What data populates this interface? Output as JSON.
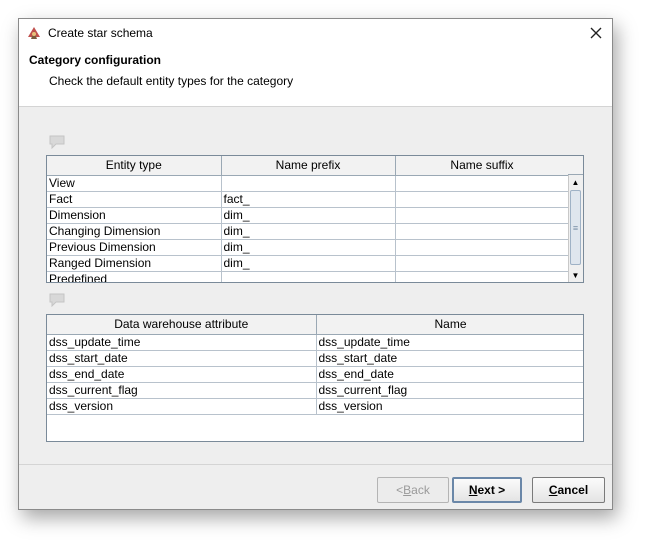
{
  "window": {
    "title": "Create star schema",
    "close_glyph": "✕"
  },
  "header": {
    "title": "Category configuration",
    "description": "Check the default entity types for the category"
  },
  "entity_table": {
    "columns": [
      "Entity type",
      "Name prefix",
      "Name suffix"
    ],
    "rows": [
      [
        "View",
        "",
        ""
      ],
      [
        "Fact",
        "fact_",
        ""
      ],
      [
        "Dimension",
        "dim_",
        ""
      ],
      [
        "Changing Dimension",
        "dim_",
        ""
      ],
      [
        "Previous Dimension",
        "dim_",
        ""
      ],
      [
        "Ranged Dimension",
        "dim_",
        ""
      ],
      [
        "Predefined",
        "",
        ""
      ]
    ],
    "scroll_up_glyph": "▲",
    "scroll_down_glyph": "▼",
    "scroll_grip_glyph": "≡"
  },
  "attribute_table": {
    "columns": [
      "Data warehouse attribute",
      "Name"
    ],
    "rows": [
      [
        "dss_update_time",
        "dss_update_time"
      ],
      [
        "dss_start_date",
        "dss_start_date"
      ],
      [
        "dss_end_date",
        "dss_end_date"
      ],
      [
        "dss_current_flag",
        "dss_current_flag"
      ],
      [
        "dss_version",
        "dss_version"
      ]
    ]
  },
  "buttons": {
    "back": {
      "prefix": "< ",
      "mnemonic": "B",
      "rest": "ack"
    },
    "next": {
      "prefix": "",
      "mnemonic": "N",
      "rest": "ext >"
    },
    "cancel": {
      "prefix": "",
      "mnemonic": "C",
      "rest": "ancel"
    }
  },
  "icons": {
    "app": "app-logo-icon",
    "message1": "comment-icon",
    "message2": "comment-icon"
  }
}
